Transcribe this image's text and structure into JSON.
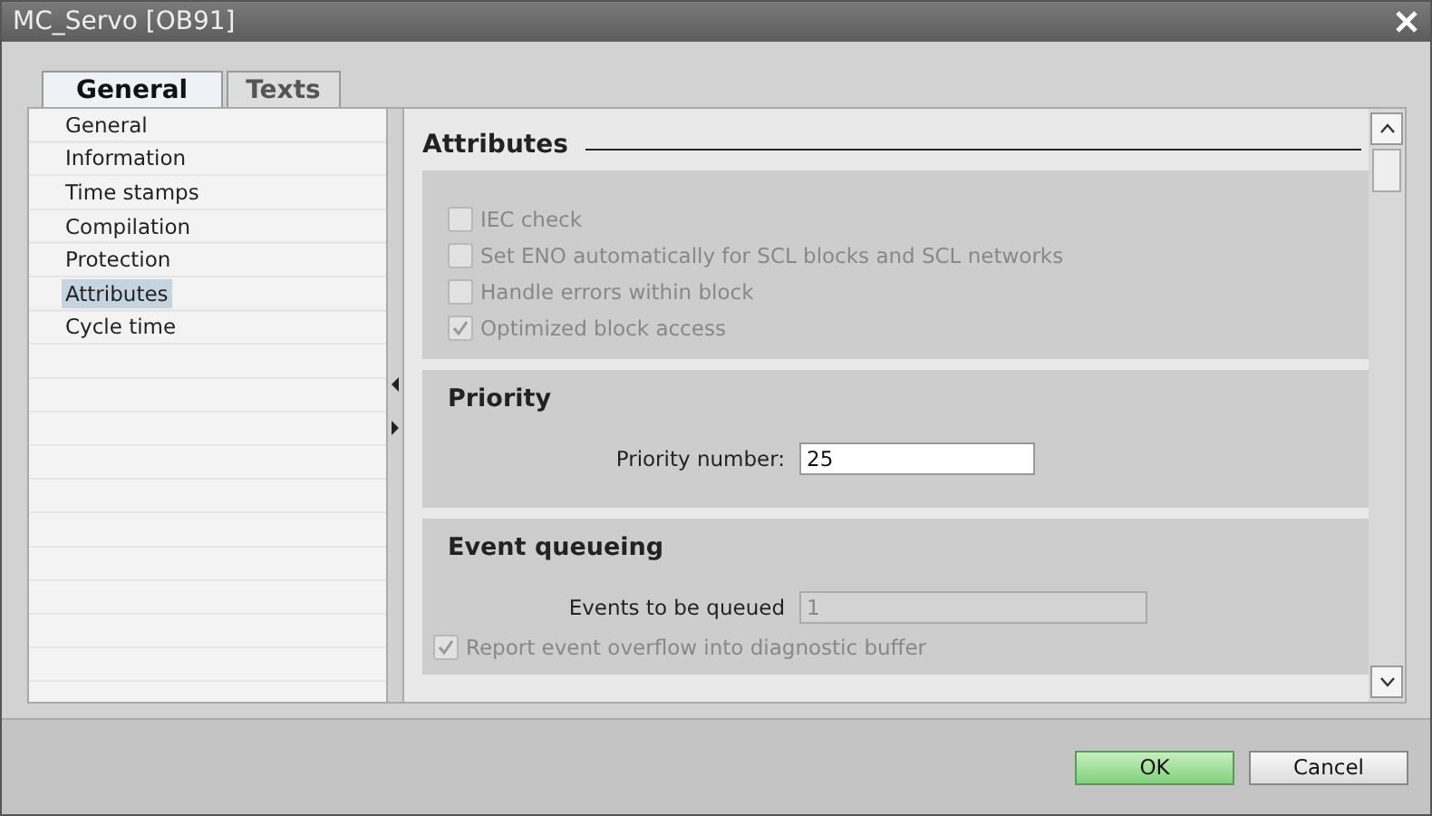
{
  "window": {
    "title": "MC_Servo [OB91]"
  },
  "tabs": [
    {
      "label": "General",
      "selected": true
    },
    {
      "label": "Texts",
      "selected": false
    }
  ],
  "nav": [
    {
      "label": "General",
      "selected": false
    },
    {
      "label": "Information",
      "selected": false
    },
    {
      "label": "Time stamps",
      "selected": false
    },
    {
      "label": "Compilation",
      "selected": false
    },
    {
      "label": "Protection",
      "selected": false
    },
    {
      "label": "Attributes",
      "selected": true
    },
    {
      "label": "Cycle time",
      "selected": false
    }
  ],
  "heading": "Attributes",
  "attributes": [
    {
      "label": "IEC check",
      "checked": false,
      "disabled": true
    },
    {
      "label": "Set ENO automatically for SCL blocks and SCL networks",
      "checked": false,
      "disabled": true
    },
    {
      "label": "Handle errors within block",
      "checked": false,
      "disabled": true
    },
    {
      "label": "Optimized block access",
      "checked": true,
      "disabled": true
    }
  ],
  "priority": {
    "title": "Priority",
    "label": "Priority number:",
    "value": "25",
    "disabled": false
  },
  "event_queueing": {
    "title": "Event queueing",
    "label": "Events to be queued",
    "value": "1",
    "disabled": true,
    "options": [
      {
        "label": "Report event overflow into diagnostic buffer",
        "checked": true,
        "disabled": true
      }
    ]
  },
  "buttons": [
    {
      "label": "OK",
      "kind": "primary"
    },
    {
      "label": "Cancel",
      "kind": "normal"
    }
  ]
}
